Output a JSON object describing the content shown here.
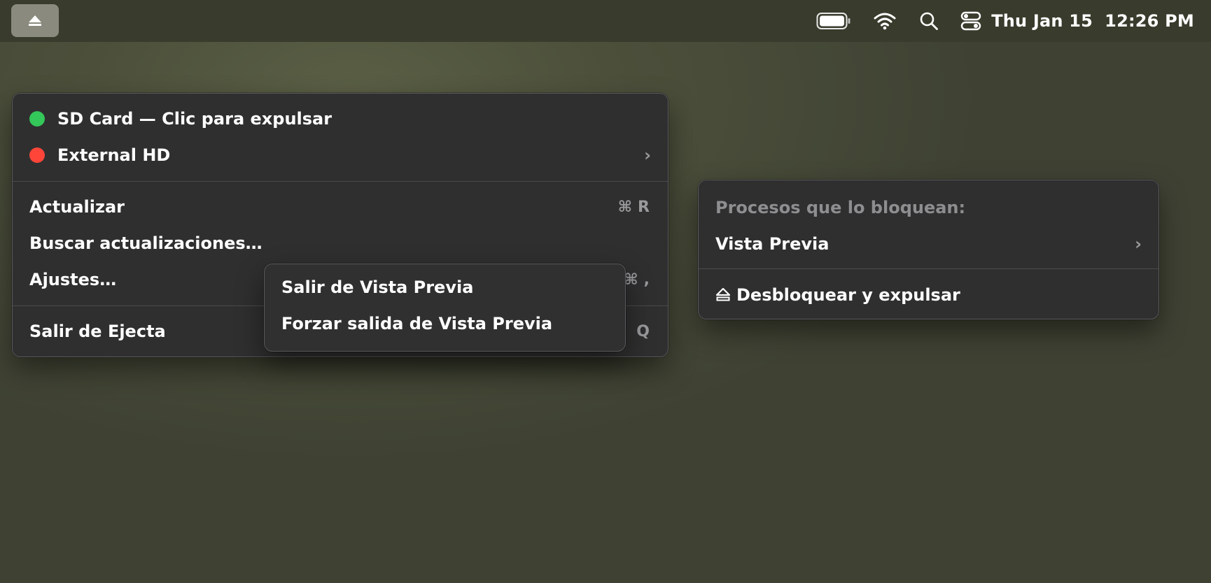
{
  "menubar": {
    "app_icon": "eject-icon",
    "status_icons": [
      "battery-icon",
      "wifi-icon",
      "search-icon",
      "control-center-icon"
    ],
    "clock": "Thu Jan 15  12:26 PM"
  },
  "main_menu": {
    "devices": [
      {
        "label": "SD Card — Clic para expulsar",
        "status_color": "#34c759"
      },
      {
        "label": "External HD",
        "status_color": "#ff453a"
      }
    ],
    "actions": [
      {
        "label": "Actualizar",
        "shortcut_symbol": "⌘",
        "shortcut_key": "R"
      },
      {
        "label": "Buscar actualizaciones…"
      },
      {
        "label": "Ajustes…",
        "shortcut_symbol": "⌘",
        "shortcut_key": ","
      }
    ],
    "quit": {
      "label": "Salir de Ejecta",
      "shortcut_key": "Q"
    }
  },
  "process_submenu": {
    "items": [
      {
        "label": "Salir de Vista Previa"
      },
      {
        "label": "Forzar salida de Vista Previa"
      }
    ]
  },
  "blocking_menu": {
    "heading": "Procesos que lo bloquean:",
    "process": "Vista Previa",
    "unlock_label": "Desbloquear y expulsar"
  }
}
